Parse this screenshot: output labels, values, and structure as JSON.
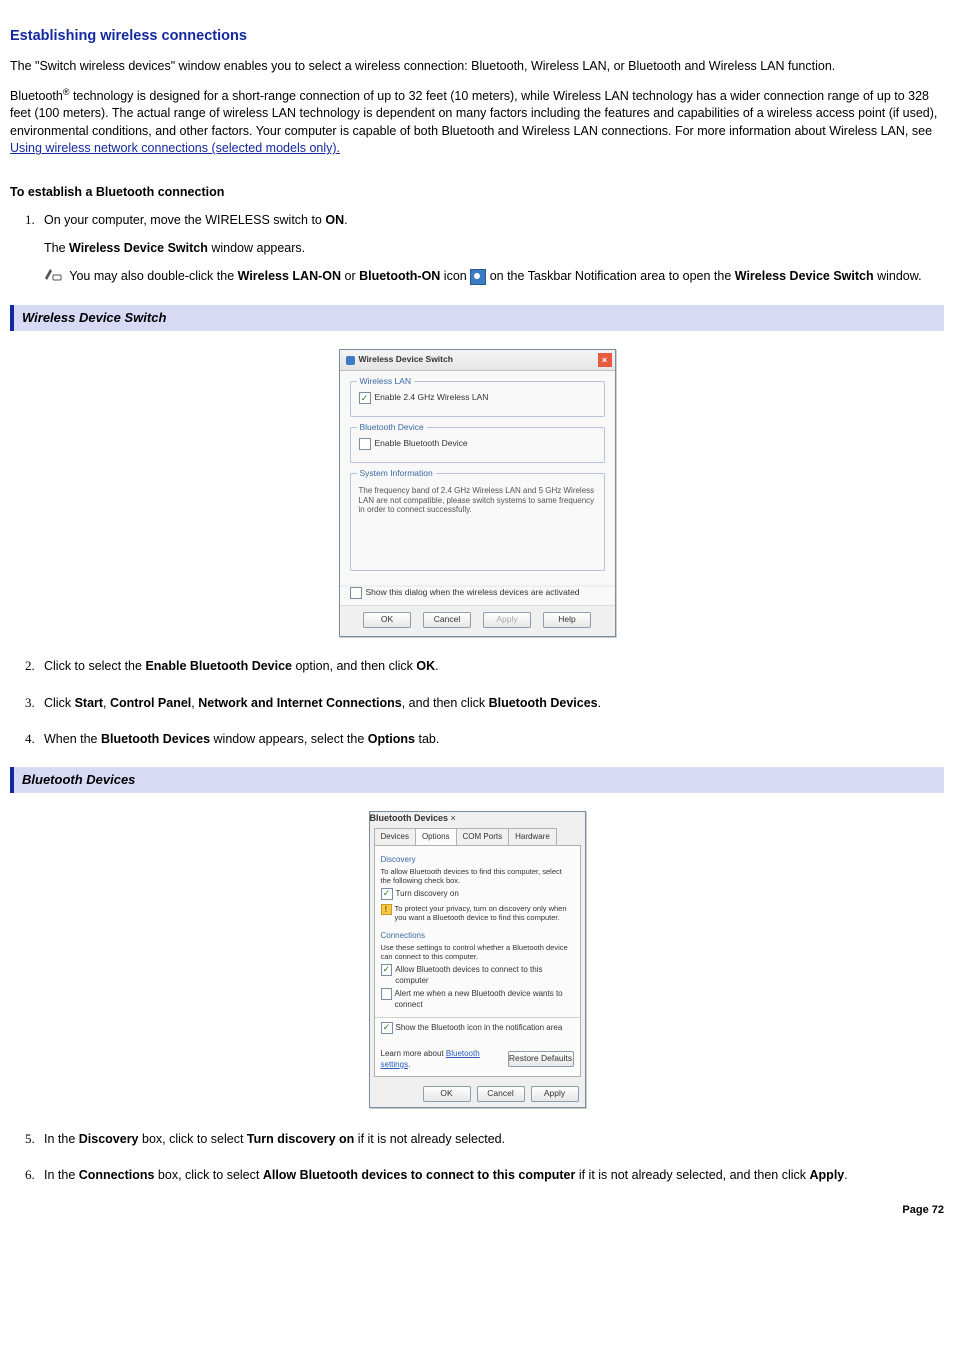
{
  "heading": "Establishing wireless connections",
  "intro1": "The \"Switch wireless devices\" window enables you to select a wireless connection: Bluetooth, Wireless LAN, or Bluetooth and Wireless LAN function.",
  "intro2a": "Bluetooth",
  "intro2sup": "®",
  "intro2b": " technology is designed for a short-range connection of up to 32 feet (10 meters), while Wireless LAN technology has a wider connection range of up to 328 feet (100 meters). The actual range of wireless LAN technology is dependent on many factors including the features and capabilities of a wireless access point (if used), environmental conditions, and other factors. Your computer is capable of both Bluetooth and Wireless LAN connections. For more information about Wireless LAN, see ",
  "intro2link": "Using wireless network connections (selected models only).",
  "subhead1": "To establish a Bluetooth connection",
  "step1a": "On your computer, move the WIRELESS switch to ",
  "step1b": "ON",
  "step1c": ".",
  "step1_sub1a": "The ",
  "step1_sub1b": "Wireless Device Switch",
  "step1_sub1c": " window appears.",
  "note1a": "You may also double-click the ",
  "note1b": "Wireless LAN-ON",
  "note1c": " or ",
  "note1d": "Bluetooth-ON",
  "note1e": " icon ",
  "note1f": " on the Taskbar Notification area to open the ",
  "note1g": "Wireless Device Switch",
  "note1h": " window.",
  "caption1": "Wireless Device Switch",
  "wds": {
    "title": "Wireless Device Switch",
    "group_wlan": "Wireless LAN",
    "chk_wlan": "Enable 2.4 GHz Wireless LAN",
    "group_bt": "Bluetooth Device",
    "chk_bt": "Enable Bluetooth Device",
    "group_sys": "System Information",
    "sys_text": "The frequency band of 2.4 GHz Wireless LAN and 5 GHz Wireless LAN are not compatible, please switch systems to same frequency in order to connect successfully.",
    "chk_show": "Show this dialog when the wireless devices are activated",
    "btn_ok": "OK",
    "btn_cancel": "Cancel",
    "btn_apply": "Apply",
    "btn_help": "Help"
  },
  "step2a": "Click to select the ",
  "step2b": "Enable Bluetooth Device",
  "step2c": " option, and then click ",
  "step2d": "OK",
  "step2e": ".",
  "step3a": "Click ",
  "step3b": "Start",
  "step3c": ", ",
  "step3d": "Control Panel",
  "step3e": ", ",
  "step3f": "Network and Internet Connections",
  "step3g": ", and then click ",
  "step3h": "Bluetooth Devices",
  "step3i": ".",
  "step4a": "When the ",
  "step4b": "Bluetooth Devices",
  "step4c": " window appears, select the ",
  "step4d": "Options",
  "step4e": " tab.",
  "caption2": "Bluetooth Devices",
  "bt": {
    "title": "Bluetooth Devices",
    "tabs": [
      "Devices",
      "Options",
      "COM Ports",
      "Hardware"
    ],
    "group_disc": "Discovery",
    "disc_text": "To allow Bluetooth devices to find this computer, select the following check box.",
    "chk_disc": "Turn discovery on",
    "disc_warn": "To protect your privacy, turn on discovery only when you want a Bluetooth device to find this computer.",
    "group_conn": "Connections",
    "conn_text": "Use these settings to control whether a Bluetooth device can connect to this computer.",
    "chk_allow": "Allow Bluetooth devices to connect to this computer",
    "chk_alert": "Alert me when a new Bluetooth device wants to connect",
    "chk_showicon": "Show the Bluetooth icon in the notification area",
    "learn_a": "Learn more about ",
    "learn_link": "Bluetooth settings",
    "btn_restore": "Restore Defaults",
    "btn_ok": "OK",
    "btn_cancel": "Cancel",
    "btn_apply": "Apply"
  },
  "step5a": "In the ",
  "step5b": "Discovery",
  "step5c": " box, click to select ",
  "step5d": "Turn discovery on",
  "step5e": " if it is not already selected.",
  "step6a": "In the ",
  "step6b": "Connections",
  "step6c": " box, click to select ",
  "step6d": "Allow Bluetooth devices to connect to this computer",
  "step6e": " if it is not already selected, and then click ",
  "step6f": "Apply",
  "step6g": ".",
  "page_num": "Page 72"
}
